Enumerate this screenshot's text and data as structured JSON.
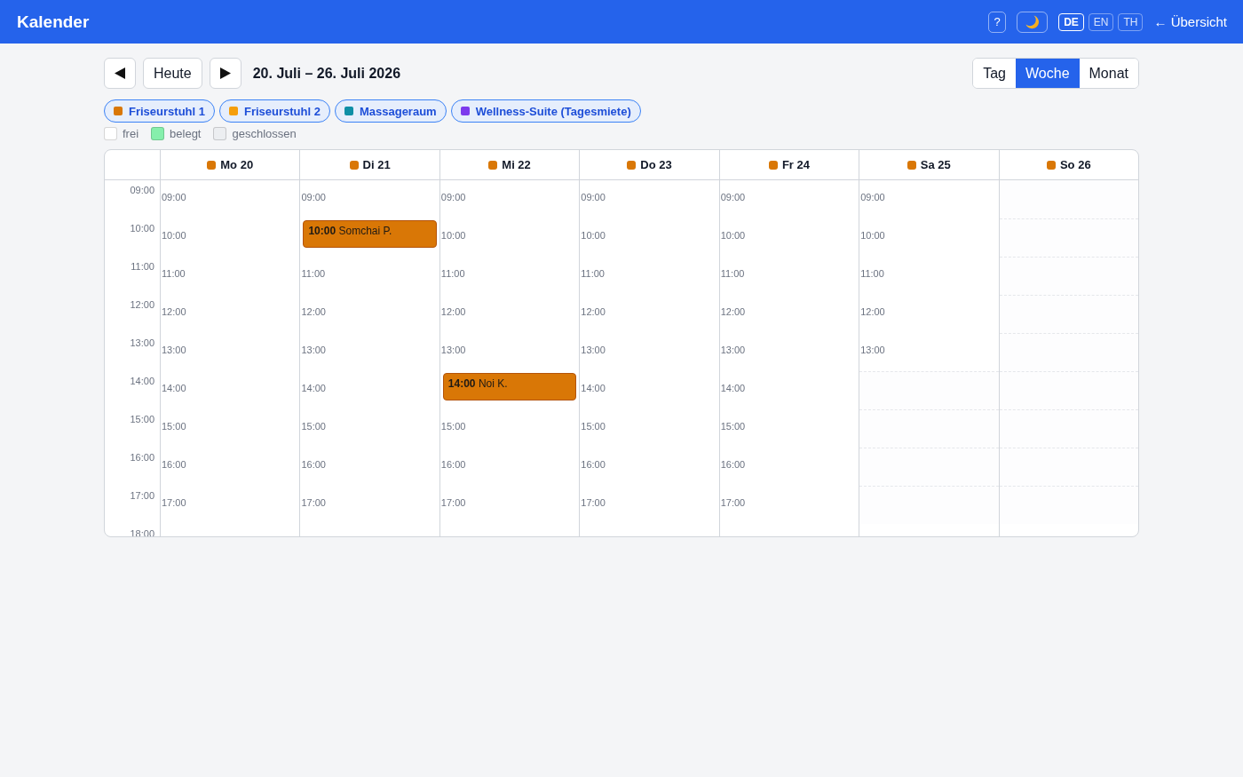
{
  "header": {
    "title": "Kalender",
    "help_button": "?",
    "languages": [
      {
        "label": "DE",
        "selected": true
      },
      {
        "label": "EN",
        "selected": false
      },
      {
        "label": "TH",
        "selected": false
      }
    ],
    "back_link": "← Übersicht"
  },
  "toolbar": {
    "today_button": "Heute",
    "range_title": "20. Juli – 26. Juli 2026",
    "views": [
      {
        "label": "Tag",
        "selected": false
      },
      {
        "label": "Woche",
        "selected": true
      },
      {
        "label": "Monat",
        "selected": false
      }
    ]
  },
  "resources": [
    {
      "label": "Friseurstuhl 1",
      "color": "#d97706",
      "selected": true
    },
    {
      "label": "Friseurstuhl 2",
      "color": "#f59e0b",
      "selected": true
    },
    {
      "label": "Massageraum",
      "color": "#0e8fa6",
      "selected": true
    },
    {
      "label": "Wellness-Suite (Tagesmiete)",
      "color": "#7c3aed",
      "selected": true
    }
  ],
  "legend": [
    {
      "label": "frei",
      "color": "#ffffff"
    },
    {
      "label": "belegt",
      "color": "#86efac"
    },
    {
      "label": "geschlossen",
      "color": "#eceef1"
    }
  ],
  "calendar": {
    "hours": [
      "09:00",
      "10:00",
      "11:00",
      "12:00",
      "13:00",
      "14:00",
      "15:00",
      "16:00",
      "17:00",
      "18:00"
    ],
    "days": [
      {
        "label": "Mo 20",
        "slots": [
          {
            "kind": "open",
            "label": "09:00"
          },
          {
            "kind": "open",
            "label": "10:00"
          },
          {
            "kind": "open",
            "label": "11:00"
          },
          {
            "kind": "open",
            "label": "12:00"
          },
          {
            "kind": "open",
            "label": "13:00"
          },
          {
            "kind": "open",
            "label": "14:00"
          },
          {
            "kind": "open",
            "label": "15:00"
          },
          {
            "kind": "open",
            "label": "16:00"
          },
          {
            "kind": "open",
            "label": "17:00"
          }
        ]
      },
      {
        "label": "Di 21",
        "slots": [
          {
            "kind": "open",
            "label": "09:00"
          },
          {
            "kind": "booking",
            "time": "10:00",
            "name": "Somchai P."
          },
          {
            "kind": "open",
            "label": "11:00"
          },
          {
            "kind": "open",
            "label": "12:00"
          },
          {
            "kind": "open",
            "label": "13:00"
          },
          {
            "kind": "open",
            "label": "14:00"
          },
          {
            "kind": "open",
            "label": "15:00"
          },
          {
            "kind": "open",
            "label": "16:00"
          },
          {
            "kind": "open",
            "label": "17:00"
          }
        ]
      },
      {
        "label": "Mi 22",
        "slots": [
          {
            "kind": "open",
            "label": "09:00"
          },
          {
            "kind": "open",
            "label": "10:00"
          },
          {
            "kind": "open",
            "label": "11:00"
          },
          {
            "kind": "open",
            "label": "12:00"
          },
          {
            "kind": "open",
            "label": "13:00"
          },
          {
            "kind": "booking",
            "time": "14:00",
            "name": "Noi K."
          },
          {
            "kind": "open",
            "label": "15:00"
          },
          {
            "kind": "open",
            "label": "16:00"
          },
          {
            "kind": "open",
            "label": "17:00"
          }
        ]
      },
      {
        "label": "Do 23",
        "slots": [
          {
            "kind": "open",
            "label": "09:00"
          },
          {
            "kind": "open",
            "label": "10:00"
          },
          {
            "kind": "open",
            "label": "11:00"
          },
          {
            "kind": "open",
            "label": "12:00"
          },
          {
            "kind": "open",
            "label": "13:00"
          },
          {
            "kind": "open",
            "label": "14:00"
          },
          {
            "kind": "open",
            "label": "15:00"
          },
          {
            "kind": "open",
            "label": "16:00"
          },
          {
            "kind": "open",
            "label": "17:00"
          }
        ]
      },
      {
        "label": "Fr 24",
        "slots": [
          {
            "kind": "open",
            "label": "09:00"
          },
          {
            "kind": "open",
            "label": "10:00"
          },
          {
            "kind": "open",
            "label": "11:00"
          },
          {
            "kind": "open",
            "label": "12:00"
          },
          {
            "kind": "open",
            "label": "13:00"
          },
          {
            "kind": "open",
            "label": "14:00"
          },
          {
            "kind": "open",
            "label": "15:00"
          },
          {
            "kind": "open",
            "label": "16:00"
          },
          {
            "kind": "open",
            "label": "17:00"
          }
        ]
      },
      {
        "label": "Sa 25",
        "slots": [
          {
            "kind": "open",
            "label": "09:00"
          },
          {
            "kind": "open",
            "label": "10:00"
          },
          {
            "kind": "open",
            "label": "11:00"
          },
          {
            "kind": "open",
            "label": "12:00"
          },
          {
            "kind": "open",
            "label": "13:00"
          },
          {
            "kind": "closed"
          },
          {
            "kind": "closed"
          },
          {
            "kind": "closed"
          },
          {
            "kind": "closed"
          }
        ]
      },
      {
        "label": "So 26",
        "slots": [
          {
            "kind": "closed"
          },
          {
            "kind": "closed"
          },
          {
            "kind": "closed"
          },
          {
            "kind": "closed"
          },
          {
            "kind": "closed"
          },
          {
            "kind": "closed"
          },
          {
            "kind": "closed"
          },
          {
            "kind": "closed"
          },
          {
            "kind": "closed"
          }
        ]
      }
    ]
  }
}
